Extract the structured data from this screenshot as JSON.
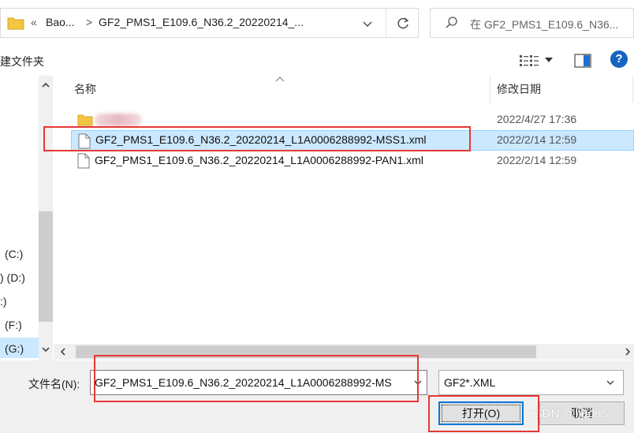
{
  "address_bar": {
    "back_chevrons": "«",
    "crumb_1": "Bao...",
    "separator": ">",
    "crumb_2": "GF2_PMS1_E109.6_N36.2_20220214_..."
  },
  "search": {
    "placeholder": "在 GF2_PMS1_E109.6_N36..."
  },
  "toolbar": {
    "new_folder_label": "建文件夹"
  },
  "nav_pane": {
    "drives": [
      {
        "label": "(C:)"
      },
      {
        "label": ") (D:)"
      },
      {
        "label": ":)"
      },
      {
        "label": "(F:)"
      },
      {
        "label": "(G:)"
      }
    ]
  },
  "file_list": {
    "columns": {
      "name": "名称",
      "modified": "修改日期"
    },
    "rows": [
      {
        "type": "folder",
        "name": "",
        "date": "2022/4/27 17:36",
        "selected": false
      },
      {
        "type": "file",
        "name": "GF2_PMS1_E109.6_N36.2_20220214_L1A0006288992-MSS1.xml",
        "date": "2022/2/14 12:59",
        "selected": true
      },
      {
        "type": "file",
        "name": "GF2_PMS1_E109.6_N36.2_20220214_L1A0006288992-PAN1.xml",
        "date": "2022/2/14 12:59",
        "selected": false
      }
    ]
  },
  "bottom": {
    "filename_label": "文件名(N):",
    "filename_value": "GF2_PMS1_E109.6_N36.2_20220214_L1A0006288992-MS",
    "filter_value": "GF2*.XML",
    "open_label": "打开(O)",
    "cancel_label": "取消",
    "watermark": "CSDN @ligous"
  },
  "colors": {
    "accent": "#0078d7",
    "selection": "#cce8ff",
    "annotation": "#e53935"
  }
}
